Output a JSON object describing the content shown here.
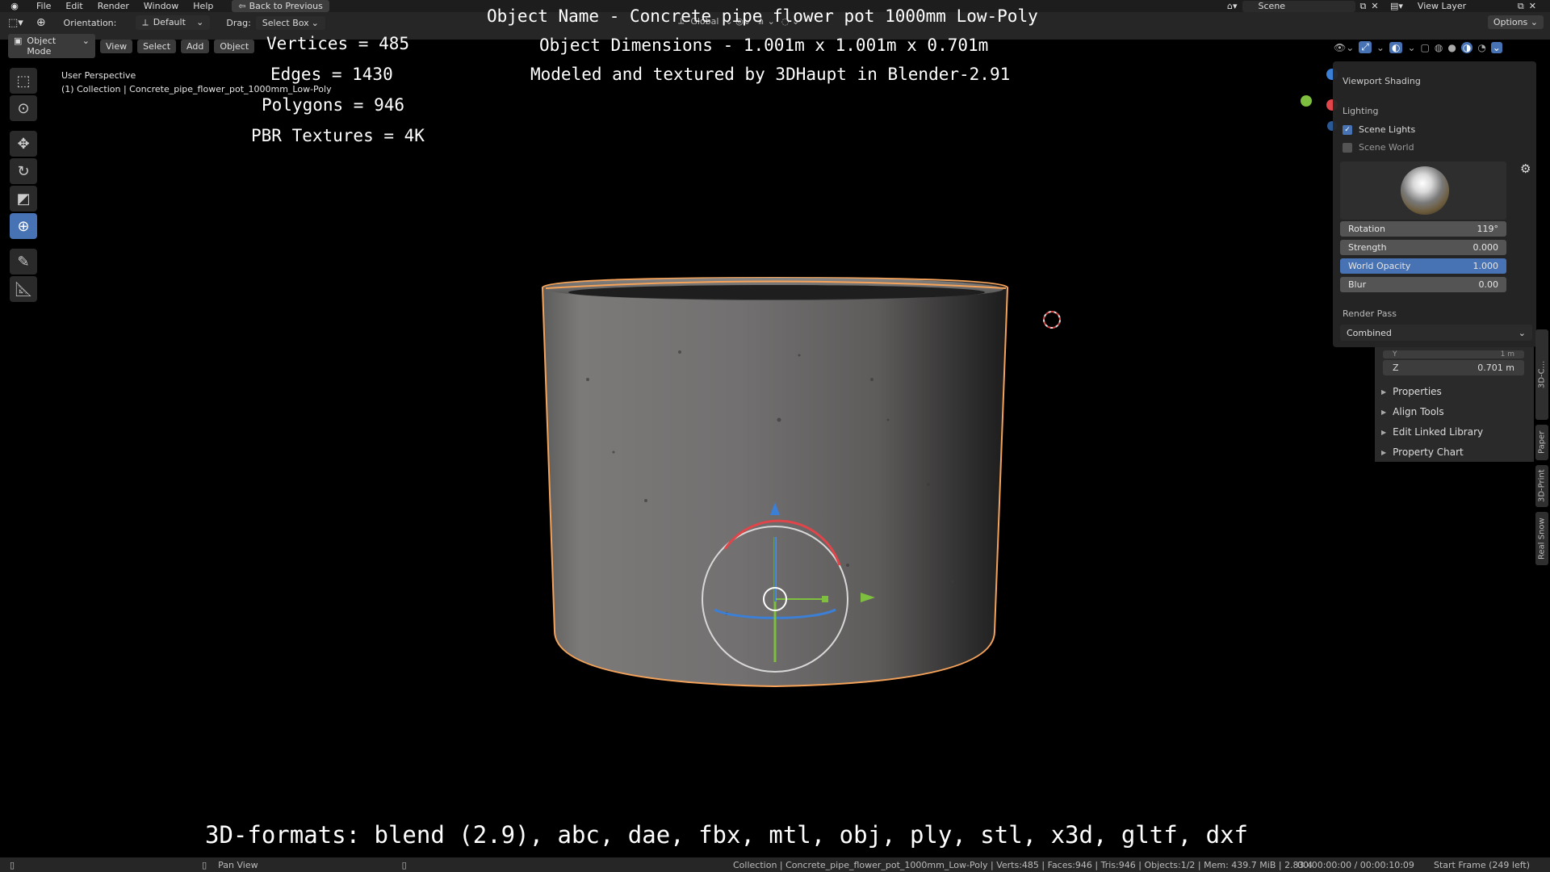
{
  "menubar": {
    "items": [
      "File",
      "Edit",
      "Render",
      "Window",
      "Help"
    ],
    "back_button": "Back to Previous",
    "scene_label": "Scene",
    "view_layer_label": "View Layer"
  },
  "toolheader": {
    "orientation_label": "Orientation:",
    "orientation_value": "Default",
    "drag_label": "Drag:",
    "drag_value": "Select Box",
    "transform_orientation": "Global",
    "options_label": "Options",
    "mode": "Object Mode",
    "menus": [
      "View",
      "Select",
      "Add",
      "Object"
    ]
  },
  "viewport": {
    "perspective": "User Perspective",
    "collection": "(1) Collection | Concrete_pipe_flower_pot_1000mm_Low-Poly"
  },
  "overlay_text": {
    "object_name": "Object Name - Concrete pipe flower pot 1000mm Low-Poly",
    "dimensions": "Object Dimensions -  1.001m x 1.001m x 0.701m",
    "credits": "Modeled and textured by 3DHaupt in Blender-2.91",
    "vertices": "Vertices = 485",
    "edges": "Edges = 1430",
    "polygons": "Polygons = 946",
    "textures": "PBR Textures = 4K",
    "formats": "3D-formats: blend (2.9), abc, dae, fbx, mtl, obj, ply, stl, x3d, gltf, dxf"
  },
  "shading_panel": {
    "title": "Viewport Shading",
    "lighting_label": "Lighting",
    "scene_lights": "Scene Lights",
    "scene_lights_checked": true,
    "scene_world": "Scene World",
    "scene_world_checked": false,
    "rotation_label": "Rotation",
    "rotation_value": "119°",
    "strength_label": "Strength",
    "strength_value": "0.000",
    "world_opacity_label": "World Opacity",
    "world_opacity_value": "1.000",
    "blur_label": "Blur",
    "blur_value": "0.00",
    "render_pass_label": "Render Pass",
    "render_pass_value": "Combined"
  },
  "npanel": {
    "y_label": "Y",
    "y_value": "1 m",
    "z_label": "Z",
    "z_value": "0.701 m",
    "sections": [
      "Properties",
      "Align Tools",
      "Edit Linked Library",
      "Property Chart"
    ]
  },
  "sidebar_tabs": [
    "3D-C...",
    "Paper",
    "3D-Print",
    "Real Snow"
  ],
  "statusbar": {
    "pan_view": "Pan View",
    "stats": "Collection | Concrete_pipe_flower_pot_1000mm_Low-Poly | Verts:485 | Faces:946 | Tris:946 | Objects:1/2 | Mem: 439.7 MiB | 2.83.4",
    "time": "00:00:00:00 / 00:00:10:09",
    "frame": "Start Frame (249 left)"
  },
  "colors": {
    "accent": "#4772b3",
    "selection_outline": "#f5a35a",
    "gizmo_x": "#e0454a",
    "gizmo_y": "#7fbf3f",
    "gizmo_z": "#3c7fd6"
  }
}
